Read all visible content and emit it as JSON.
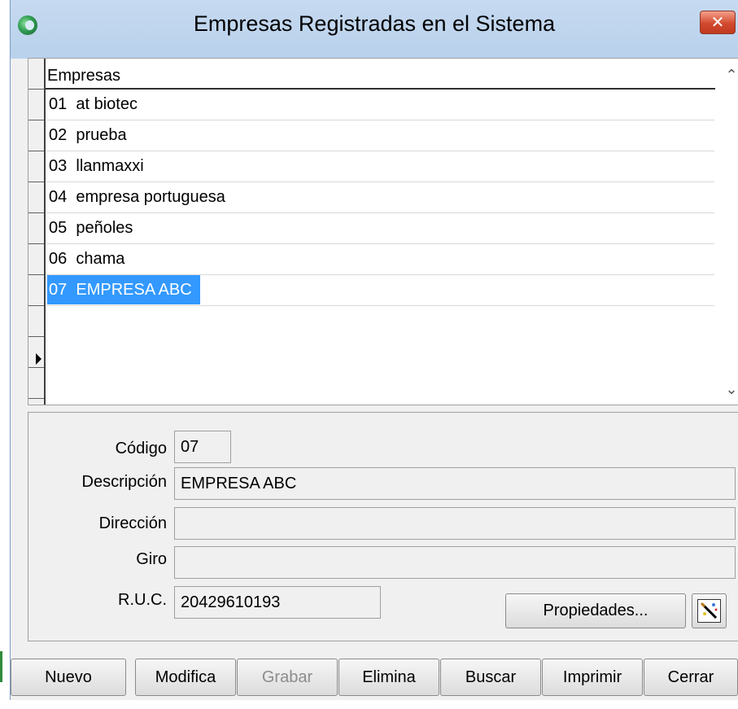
{
  "window": {
    "title": "Empresas Registradas en el Sistema",
    "close_label": "✕"
  },
  "grid": {
    "header": "Empresas",
    "rows": [
      {
        "code": "01",
        "name": "at biotec"
      },
      {
        "code": "02",
        "name": "prueba"
      },
      {
        "code": "03",
        "name": "llanmaxxi"
      },
      {
        "code": "04",
        "name": "empresa portuguesa"
      },
      {
        "code": "05",
        "name": "peñoles"
      },
      {
        "code": "06",
        "name": "chama"
      },
      {
        "code": "07",
        "name": "EMPRESA ABC"
      }
    ],
    "selected_index": 6,
    "scroll_up_icon": "chevron-up-icon",
    "scroll_down_icon": "chevron-down-icon"
  },
  "form": {
    "codigo_label": "Código",
    "codigo_value": "07",
    "descripcion_label": "Descripción",
    "descripcion_value": "EMPRESA ABC",
    "direccion_label": "Dirección",
    "direccion_value": "",
    "giro_label": "Giro",
    "giro_value": "",
    "ruc_label": "R.U.C.",
    "ruc_value": "20429610193",
    "propiedades_label": "Propiedades...",
    "wand_icon": "magic-wand-icon"
  },
  "buttons": {
    "nuevo": "Nuevo",
    "modifica": "Modifica",
    "grabar": "Grabar",
    "elimina": "Elimina",
    "buscar": "Buscar",
    "imprimir": "Imprimir",
    "cerrar": "Cerrar"
  },
  "colors": {
    "selection": "#3399ff",
    "titlebar": "#c6daf0",
    "close": "#d24a2e"
  }
}
